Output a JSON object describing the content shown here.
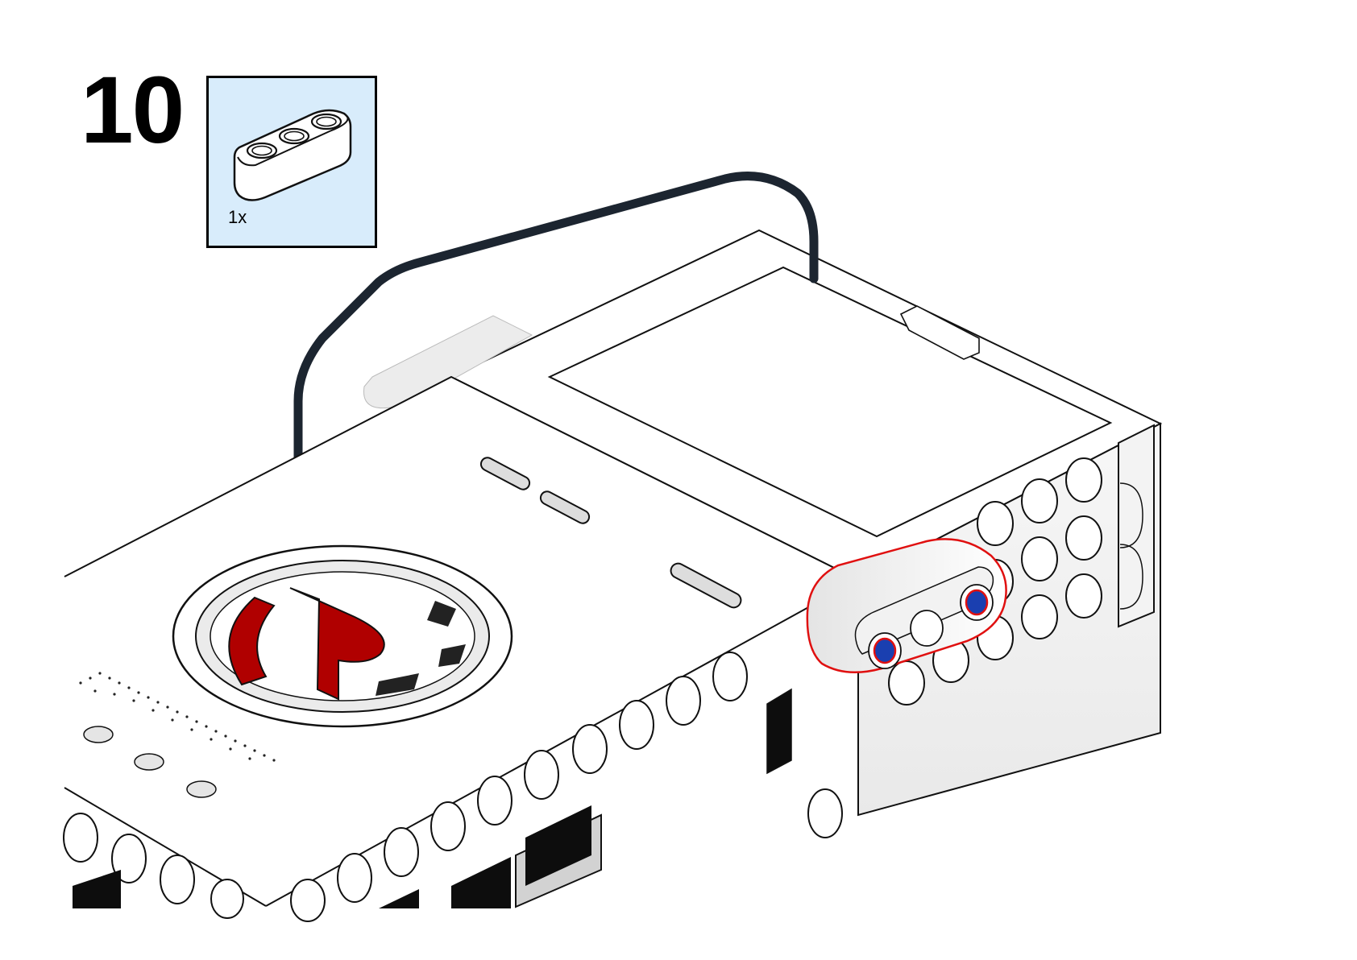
{
  "step": {
    "number": "10"
  },
  "parts_list": [
    {
      "part": "beam-3-liftarm-icon",
      "quantity": "1x"
    }
  ],
  "colors": {
    "background": "#ffffff",
    "parts_box_fill": "#d8ecfb",
    "highlight_outline": "#e01010",
    "logo_red": "#b00000",
    "pin_blue": "#1a3fb0",
    "cable": "#1c2530"
  }
}
